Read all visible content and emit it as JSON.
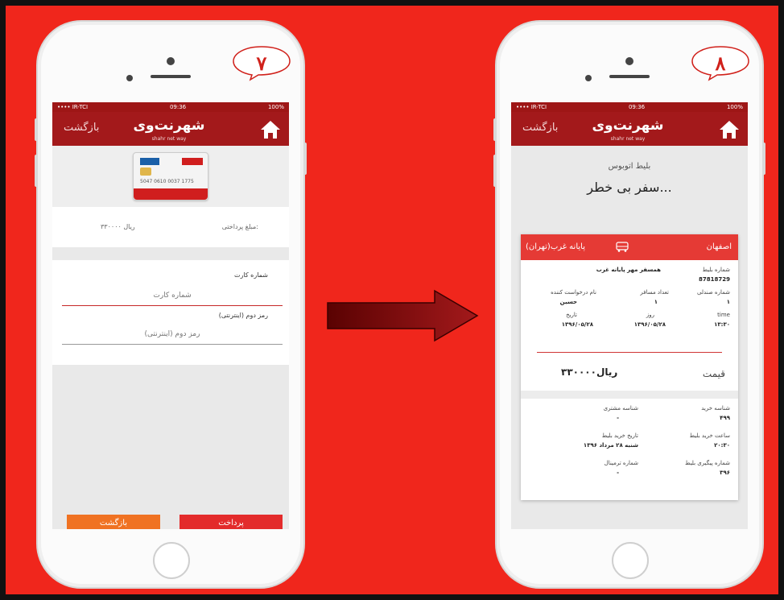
{
  "status_bar": {
    "carrier": "•••• IR-TCI",
    "time": "09:36",
    "battery": "100%"
  },
  "app": {
    "logo": "شهرنت‌وی",
    "logo_sub": "shahr net way",
    "back_label": "بازگشت"
  },
  "steps": {
    "left_number": "۷",
    "right_number": "۸"
  },
  "card": {
    "number": "5047 0610 0037 1775"
  },
  "payment_screen": {
    "amount_label": "مبلغ پرداختی:",
    "amount_value": "ریال ۳۳۰۰۰۰",
    "card_number_label": "شماره کارت",
    "card_number_placeholder": "شماره کارت",
    "pin_label": "رمز دوم (اینترنتی)",
    "pin_placeholder": "رمز دوم (اینترنتی)",
    "pay_button": "پرداخت",
    "back_button": "بازگشت"
  },
  "ticket_screen": {
    "title": "بلیط اتوبوس",
    "slogan": "سفر بی خطر...",
    "from": "اصفهان",
    "to": "پایانه غرب(تهران)",
    "ticket_number_label": "شماره بلیط",
    "ticket_number": "87818729",
    "company": "همسفر مهر پایانه غرب",
    "seat_label": "شماره صندلی",
    "seat_value": "۱",
    "passengers_label": "تعداد مسافر",
    "passengers_value": "۱",
    "requester_label": "نام درخواست کننده",
    "requester_value": "حسین",
    "time_label": "time",
    "time_value": "۱۳:۳۰",
    "day_label": "روز",
    "day_value": "۱۳۹۶/۰۵/۲۸",
    "date_label": "تاریخ",
    "date_value": "۱۳۹۶/۰۵/۲۸",
    "price_label": "قیمت",
    "price_value": "۳۳۰۰۰۰ریال",
    "buy_id_label": "شناسه خرید",
    "buy_id_value": "۴۹۹",
    "customer_id_label": "شناسه مشتری",
    "customer_id_value": "-",
    "buy_time_label": "ساعت خرید بلیط",
    "buy_time_value": "۲۰:۳۰",
    "buy_date_label": "تاریخ خرید بلیط",
    "buy_date_value": "شنبه ۲۸ مرداد ۱۳۹۶",
    "tracking_label": "شماره پیگیری بلیط",
    "tracking_value": "۳۹۶",
    "terminal_label": "شماره ترمینال",
    "terminal_value": "-"
  },
  "colors": {
    "background": "#f0261c",
    "header": "#a3191b",
    "pay_button": "#e32b2b",
    "back_button": "#f07222"
  }
}
